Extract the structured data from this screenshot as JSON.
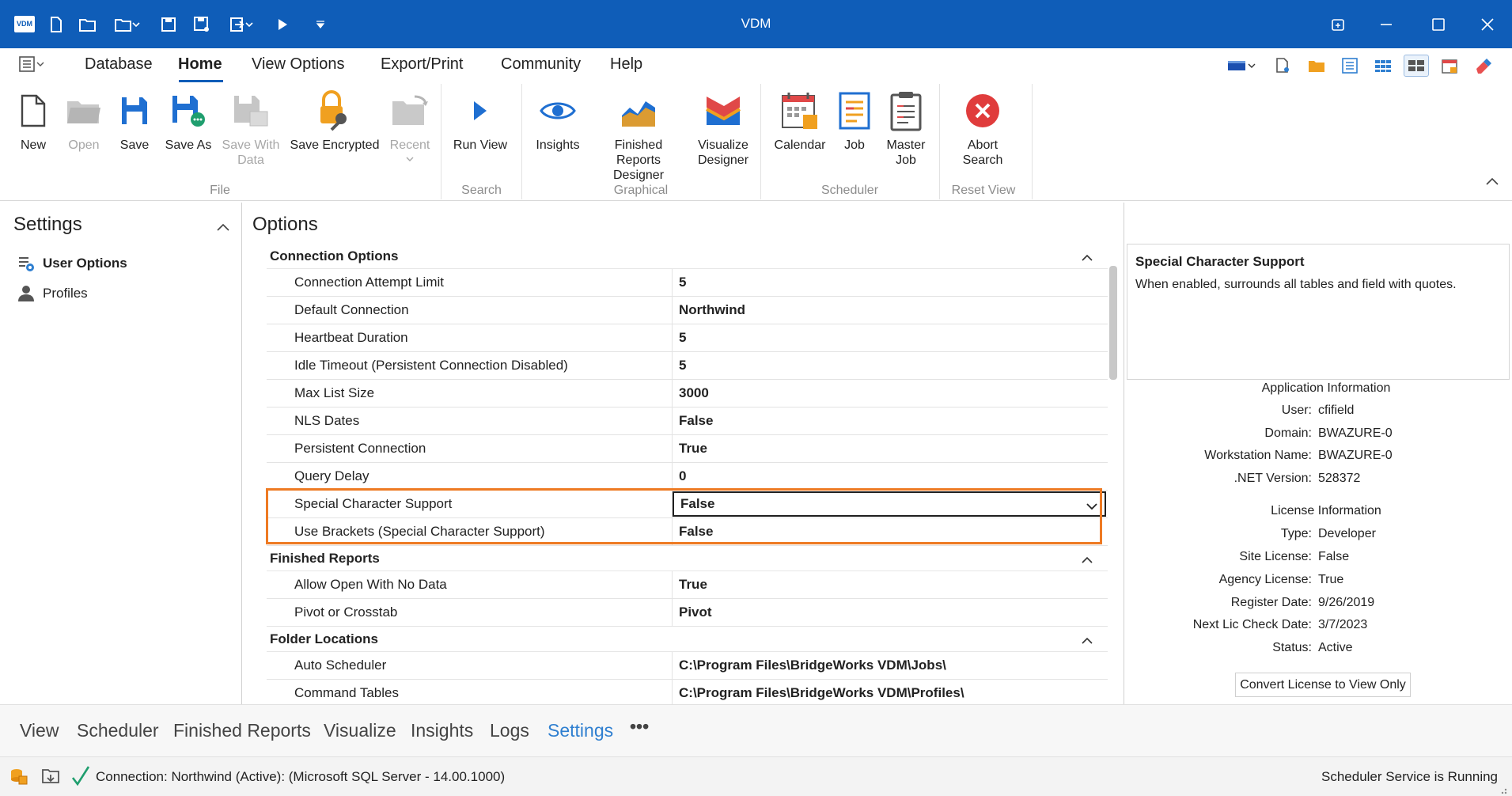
{
  "window": {
    "title": "VDM",
    "logo": "VDM"
  },
  "quick_access": [
    "new-doc-icon",
    "open-folder-icon",
    "open-recent-icon",
    "save-icon",
    "save-with-data-icon",
    "export-icon",
    "run-icon",
    "customize-icon"
  ],
  "menu": {
    "items": [
      "Database",
      "Home",
      "View Options",
      "Export/Print",
      "Community",
      "Help"
    ],
    "active": "Home"
  },
  "ribbon": {
    "file": {
      "new": "New",
      "open": "Open",
      "save": "Save",
      "save_as": "Save As",
      "save_with_data": "Save With Data",
      "save_encrypted": "Save Encrypted",
      "recent": "Recent",
      "group": "File"
    },
    "search": {
      "run_view": "Run View",
      "group": "Search"
    },
    "graphical": {
      "insights": "Insights",
      "finished_reports_designer": "Finished Reports Designer",
      "visualize_designer": "Visualize Designer",
      "group": "Graphical"
    },
    "scheduler": {
      "calendar": "Calendar",
      "job": "Job",
      "master_job": "Master Job",
      "group": "Scheduler"
    },
    "reset_view": {
      "abort_search": "Abort Search",
      "group": "Reset View"
    }
  },
  "settings": {
    "title": "Settings",
    "items": [
      {
        "label": "User Options",
        "active": true
      },
      {
        "label": "Profiles",
        "active": false
      }
    ]
  },
  "options": {
    "title": "Options",
    "categories": [
      {
        "name": "Connection Options",
        "rows": [
          {
            "name": "Connection Attempt Limit",
            "value": "5"
          },
          {
            "name": "Default Connection",
            "value": "Northwind"
          },
          {
            "name": "Heartbeat Duration",
            "value": "5"
          },
          {
            "name": "Idle Timeout (Persistent Connection Disabled)",
            "value": "5"
          },
          {
            "name": "Max List Size",
            "value": "3000"
          },
          {
            "name": "NLS Dates",
            "value": "False"
          },
          {
            "name": "Persistent Connection",
            "value": "True"
          },
          {
            "name": "Query Delay",
            "value": "0"
          },
          {
            "name": "Special Character Support",
            "value": "False"
          },
          {
            "name": "Use Brackets (Special Character Support)",
            "value": "False"
          }
        ]
      },
      {
        "name": "Finished Reports",
        "rows": [
          {
            "name": "Allow Open With No Data",
            "value": "True"
          },
          {
            "name": "Pivot or Crosstab",
            "value": "Pivot"
          }
        ]
      },
      {
        "name": "Folder Locations",
        "rows": [
          {
            "name": "Auto Scheduler",
            "value": "C:\\Program Files\\BridgeWorks VDM\\Jobs\\"
          },
          {
            "name": "Command Tables",
            "value": "C:\\Program Files\\BridgeWorks VDM\\Profiles\\"
          }
        ]
      }
    ]
  },
  "description": {
    "title": "Special Character Support",
    "text": "When enabled, surrounds all tables and field with quotes."
  },
  "app_info": {
    "title": "Application Information",
    "rows": [
      {
        "k": "User:",
        "v": "cfifield"
      },
      {
        "k": "Domain:",
        "v": "BWAZURE-0"
      },
      {
        "k": "Workstation Name:",
        "v": "BWAZURE-0"
      },
      {
        "k": ".NET Version:",
        "v": "528372"
      }
    ]
  },
  "license_info": {
    "title": "License Information",
    "rows": [
      {
        "k": "Type:",
        "v": "Developer"
      },
      {
        "k": "Site License:",
        "v": "False"
      },
      {
        "k": "Agency License:",
        "v": "True"
      },
      {
        "k": "Register Date:",
        "v": "9/26/2019"
      },
      {
        "k": "Next Lic Check Date:",
        "v": "3/7/2023"
      },
      {
        "k": "Status:",
        "v": "Active"
      }
    ],
    "convert_button": "Convert License to View Only"
  },
  "bottom_nav": {
    "items": [
      "View",
      "Scheduler",
      "Finished Reports",
      "Visualize",
      "Insights",
      "Logs",
      "Settings"
    ],
    "active": "Settings",
    "more": "•••"
  },
  "status": {
    "connection": "Connection: Northwind (Active): (Microsoft SQL Server - 14.00.1000)",
    "scheduler": "Scheduler Service is Running"
  },
  "colors": {
    "title_bar": "#0f5db8",
    "accent": "#2f7fd0",
    "highlight": "#ee7a23"
  }
}
